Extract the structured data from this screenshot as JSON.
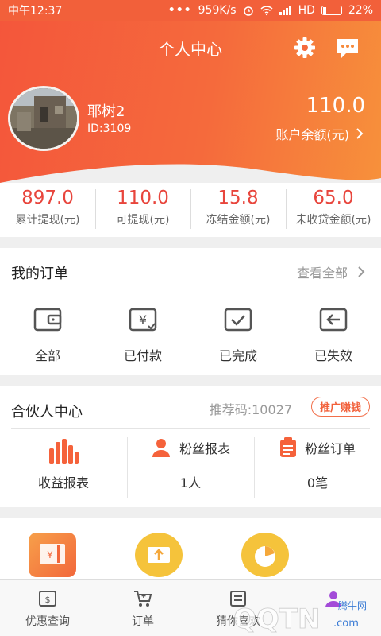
{
  "status_bar": {
    "time": "中午12:37",
    "network_speed": "959K/s",
    "signal": "HD",
    "battery": "22%"
  },
  "header": {
    "title": "个人中心",
    "icons": [
      "gear-icon",
      "message-icon"
    ]
  },
  "user": {
    "name": "耶树2",
    "id": "ID:3109",
    "balance": "110.0",
    "balance_label": "账户余额(元)"
  },
  "stats": [
    {
      "value": "897.0",
      "label": "累计提现(元)"
    },
    {
      "value": "110.0",
      "label": "可提现(元)"
    },
    {
      "value": "15.8",
      "label": "冻结金额(元)"
    },
    {
      "value": "65.0",
      "label": "未收贷金额(元)"
    }
  ],
  "orders": {
    "title": "我的订单",
    "view_all": "查看全部",
    "items": [
      {
        "label": "全部",
        "icon": "wallet-icon"
      },
      {
        "label": "已付款",
        "icon": "paid-icon"
      },
      {
        "label": "已完成",
        "icon": "completed-icon"
      },
      {
        "label": "已失效",
        "icon": "expired-icon"
      }
    ]
  },
  "partner": {
    "title": "合伙人中心",
    "referral_code": "推荐码:10027",
    "promo_button": "推广赚钱",
    "columns": [
      {
        "label": "收益报表",
        "value": "",
        "icon": "bar-chart-icon"
      },
      {
        "label": "粉丝报表",
        "value": "1人",
        "icon": "person-icon"
      },
      {
        "label": "粉丝订单",
        "value": "0笔",
        "icon": "clipboard-icon"
      }
    ]
  },
  "bottom_nav": [
    {
      "label": "优惠查询",
      "icon": "coupon-icon"
    },
    {
      "label": "订单",
      "icon": "cart-icon"
    },
    {
      "label": "猜你喜欢",
      "icon": "list-icon"
    },
    {
      "label": "",
      "icon": "profile-icon"
    }
  ],
  "watermark": {
    "text": "QQTN",
    "small": "腾牛网",
    "domain": ".com"
  },
  "colors": {
    "brand": "#f2603a",
    "value_red": "#e8453c",
    "header_gradient_end": "#f7913b"
  }
}
